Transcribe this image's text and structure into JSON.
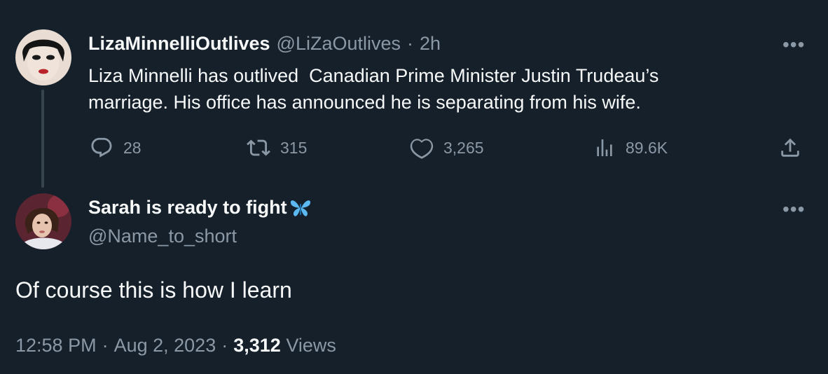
{
  "parent_tweet": {
    "display_name": "LizaMinnelliOutlives",
    "handle": "@LiZaOutlives",
    "separator": "·",
    "time": "2h",
    "text_line1": "Liza Minnelli has outlived  Canadian Prime Minister Justin Trudeau’s",
    "text_line2": "marriage. His office has announced he is separating from his wife.",
    "more_label": "•••",
    "actions": {
      "replies": "28",
      "retweets": "315",
      "likes": "3,265",
      "views": "89.6K"
    }
  },
  "reply_tweet": {
    "display_name": "Sarah is ready to fight",
    "handle": "@Name_to_short",
    "more_label": "•••",
    "text": "Of course this is how I learn",
    "time": "12:58 PM",
    "separator": "·",
    "date": "Aug 2, 2023",
    "separator2": "·",
    "views_count": "3,312",
    "views_label": "Views"
  },
  "colors": {
    "background": "#15202b",
    "primary_text": "#f7f9f9",
    "secondary_text": "#8b98a5",
    "thread_line": "#38444d",
    "butterfly": "#5bb8f0"
  }
}
